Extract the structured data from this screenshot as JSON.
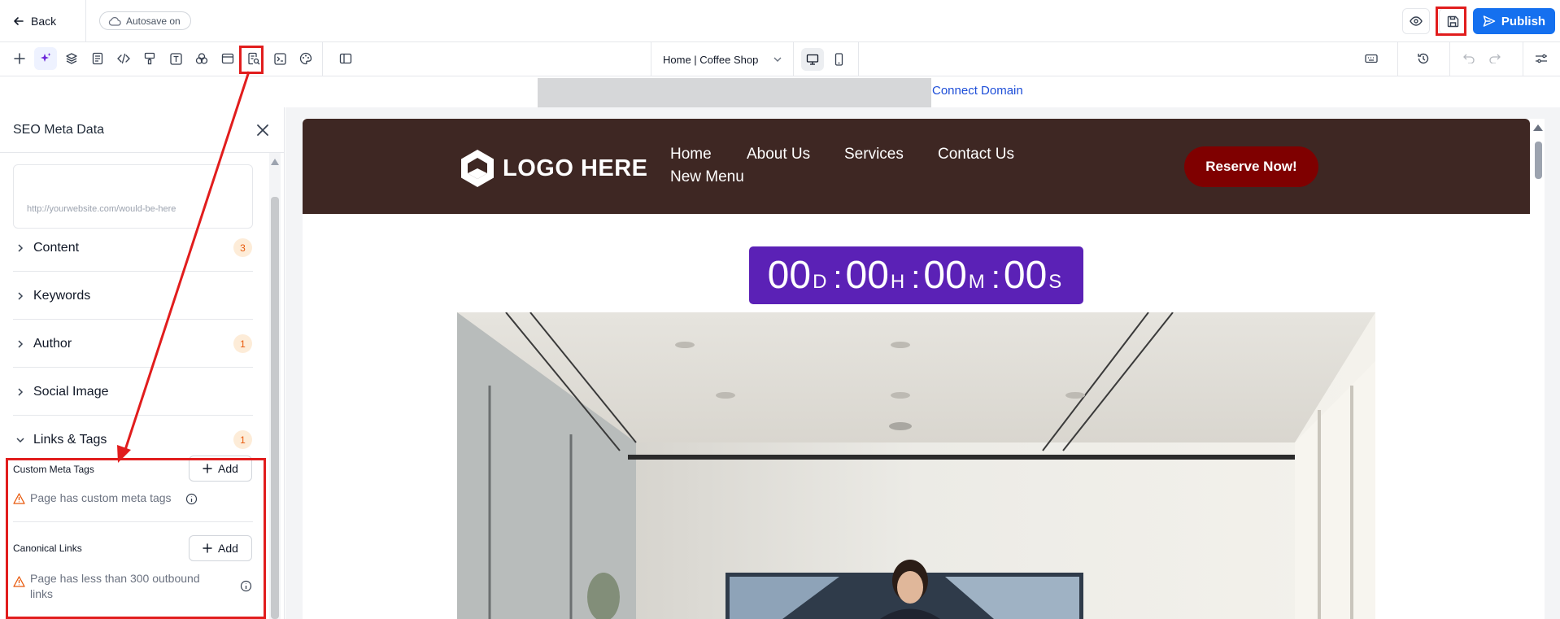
{
  "topbar": {
    "back_label": "Back",
    "autosave_label": "Autosave on",
    "publish_label": "Publish"
  },
  "toolbar": {
    "page_selector": "Home | Coffee Shop"
  },
  "domain_bar": {
    "connect_domain": "Connect Domain"
  },
  "seo_panel": {
    "title": "SEO Meta Data",
    "url_placeholder": "http://yourwebsite.com/would-be-here",
    "sections": [
      {
        "label": "Content",
        "badge": "3"
      },
      {
        "label": "Keywords",
        "badge": ""
      },
      {
        "label": "Author",
        "badge": "1"
      },
      {
        "label": "Social Image",
        "badge": ""
      },
      {
        "label": "Links & Tags",
        "badge": "1"
      }
    ],
    "custom_meta_tags": {
      "label": "Custom Meta Tags",
      "add_label": "Add",
      "warning": "Page has custom meta tags"
    },
    "canonical_links": {
      "label": "Canonical Links",
      "add_label": "Add",
      "warning_line1": "Page has less than 300 outbound",
      "warning_line2": "links"
    }
  },
  "site": {
    "logo_text": "LOGO HERE",
    "nav": [
      "Home",
      "About Us",
      "Services",
      "Contact Us",
      "New Menu"
    ],
    "cta": "Reserve Now!",
    "countdown": {
      "days": "00",
      "days_unit": "D",
      "hours": "00",
      "hours_unit": "H",
      "minutes": "00",
      "minutes_unit": "M",
      "seconds": "00",
      "seconds_unit": "S"
    }
  },
  "colors": {
    "publish": "#1570ef",
    "header_bg": "#3e2723",
    "cta_bg": "#7f0000",
    "countdown_bg": "#5b21b6",
    "annotation_red": "#e11d1d",
    "badge_text": "#e8590c",
    "link_blue": "#1d4ed8"
  },
  "icons": {
    "toolbar": [
      "plus-icon",
      "ai-sparkle-icon",
      "layers-icon",
      "pages-icon",
      "code-icon",
      "paint-brush-icon",
      "text-icon",
      "shapes-icon",
      "browser-icon",
      "seo-meta-icon",
      "terminal-icon",
      "palette-icon",
      "split-view-icon"
    ],
    "right_toolbar": [
      "keyboard-icon",
      "history-icon",
      "undo-icon",
      "redo-icon",
      "settings-sliders-icon"
    ]
  }
}
